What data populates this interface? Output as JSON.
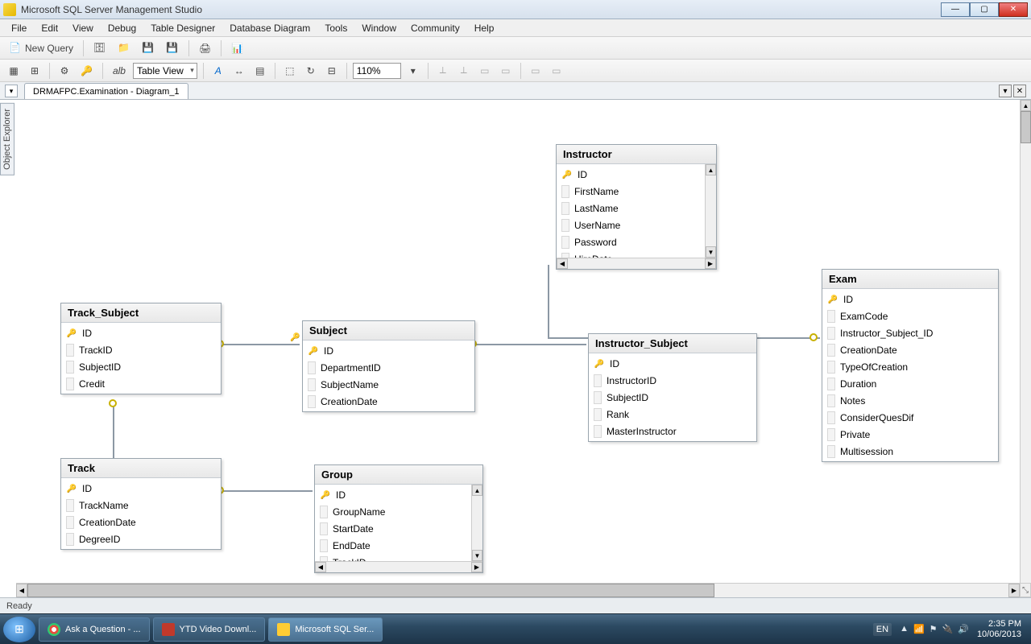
{
  "window": {
    "title": "Microsoft SQL Server Management Studio"
  },
  "menu": {
    "file": "File",
    "edit": "Edit",
    "view": "View",
    "debug": "Debug",
    "tableDesigner": "Table Designer",
    "databaseDiagram": "Database Diagram",
    "tools": "Tools",
    "window": "Window",
    "community": "Community",
    "help": "Help"
  },
  "toolbar1": {
    "newQuery": "New Query"
  },
  "toolbar2": {
    "tableView": "Table View",
    "zoom": "110%",
    "alb": "alb"
  },
  "docTab": {
    "title": "DRMAFPC.Examination - Diagram_1"
  },
  "sidebar": {
    "objectExplorer": "Object Explorer"
  },
  "tables": {
    "instructor": {
      "name": "Instructor",
      "cols": [
        "ID",
        "FirstName",
        "LastName",
        "UserName",
        "Password",
        "HireDate"
      ]
    },
    "trackSubject": {
      "name": "Track_Subject",
      "cols": [
        "ID",
        "TrackID",
        "SubjectID",
        "Credit"
      ]
    },
    "subject": {
      "name": "Subject",
      "cols": [
        "ID",
        "DepartmentID",
        "SubjectName",
        "CreationDate"
      ]
    },
    "instructorSubject": {
      "name": "Instructor_Subject",
      "cols": [
        "ID",
        "InstructorID",
        "SubjectID",
        "Rank",
        "MasterInstructor"
      ]
    },
    "exam": {
      "name": "Exam",
      "cols": [
        "ID",
        "ExamCode",
        "Instructor_Subject_ID",
        "CreationDate",
        "TypeOfCreation",
        "Duration",
        "Notes",
        "ConsiderQuesDif",
        "Private",
        "Multisession"
      ]
    },
    "track": {
      "name": "Track",
      "cols": [
        "ID",
        "TrackName",
        "CreationDate",
        "DegreeID"
      ]
    },
    "group": {
      "name": "Group",
      "cols": [
        "ID",
        "GroupName",
        "StartDate",
        "EndDate",
        "TrackID"
      ]
    }
  },
  "statusbar": {
    "ready": "Ready"
  },
  "taskbar": {
    "items": [
      "Ask a Question - ...",
      "YTD Video Downl...",
      "Microsoft SQL Ser..."
    ],
    "lang": "EN",
    "time": "2:35 PM",
    "date": "10/06/2013"
  }
}
